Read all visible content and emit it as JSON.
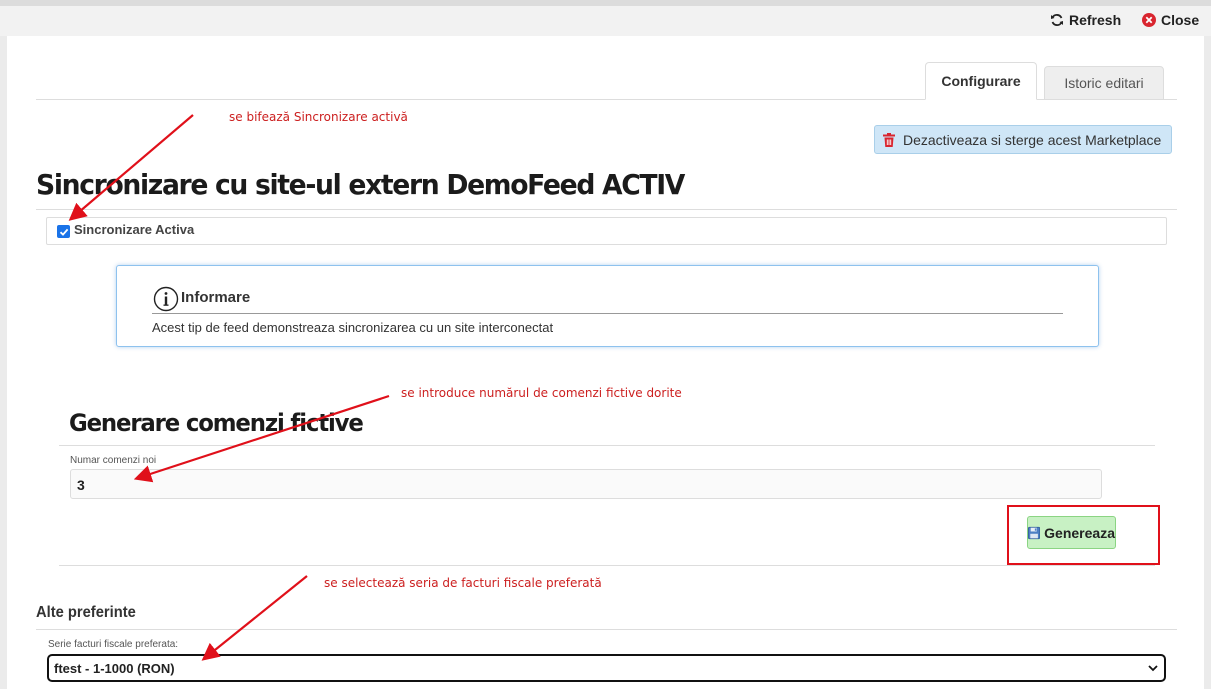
{
  "toolbar": {
    "refresh_label": "Refresh",
    "close_label": "Close"
  },
  "tabs": [
    {
      "label": "Configurare",
      "active": true
    },
    {
      "label": "Istoric editari",
      "active": false
    }
  ],
  "deactivate_button_label": "Dezactiveaza si sterge acest Marketplace",
  "sync_section": {
    "title": "Sincronizare cu site-ul extern DemoFeed ACTIV",
    "checkbox_label": "Sincronizare Activa",
    "checked": true
  },
  "info_box": {
    "title": "Informare",
    "text": "Acest tip de feed demonstreaza sincronizarea cu un site interconectat"
  },
  "generate_section": {
    "title": "Generare comenzi fictive",
    "field_label": "Numar comenzi noi",
    "field_value": "3",
    "button_label": "Genereaza"
  },
  "preferences_section": {
    "title": "Alte preferinte",
    "select_label": "Serie facturi fiscale preferata:",
    "select_value": "ftest - 1-1000 (RON)"
  },
  "annotations": {
    "note1": "se bifează Sincronizare activă",
    "note2": "se introduce numărul de comenzi fictive dorite",
    "note3": "se selectează seria de facturi fiscale preferată"
  },
  "colors": {
    "annotation_red": "#e0101a",
    "checkbox_blue": "#1a73e8",
    "generate_button_green": "#c8f1c4",
    "deactivate_button_blue": "#cfe6f7",
    "trash_icon_red": "#d9252f"
  },
  "icons": {
    "refresh": "refresh-icon",
    "close": "close-circle-icon",
    "trash": "trash-icon",
    "info": "info-circle-icon",
    "save": "floppy-disk-icon",
    "dropdown": "chevron-down-icon"
  }
}
